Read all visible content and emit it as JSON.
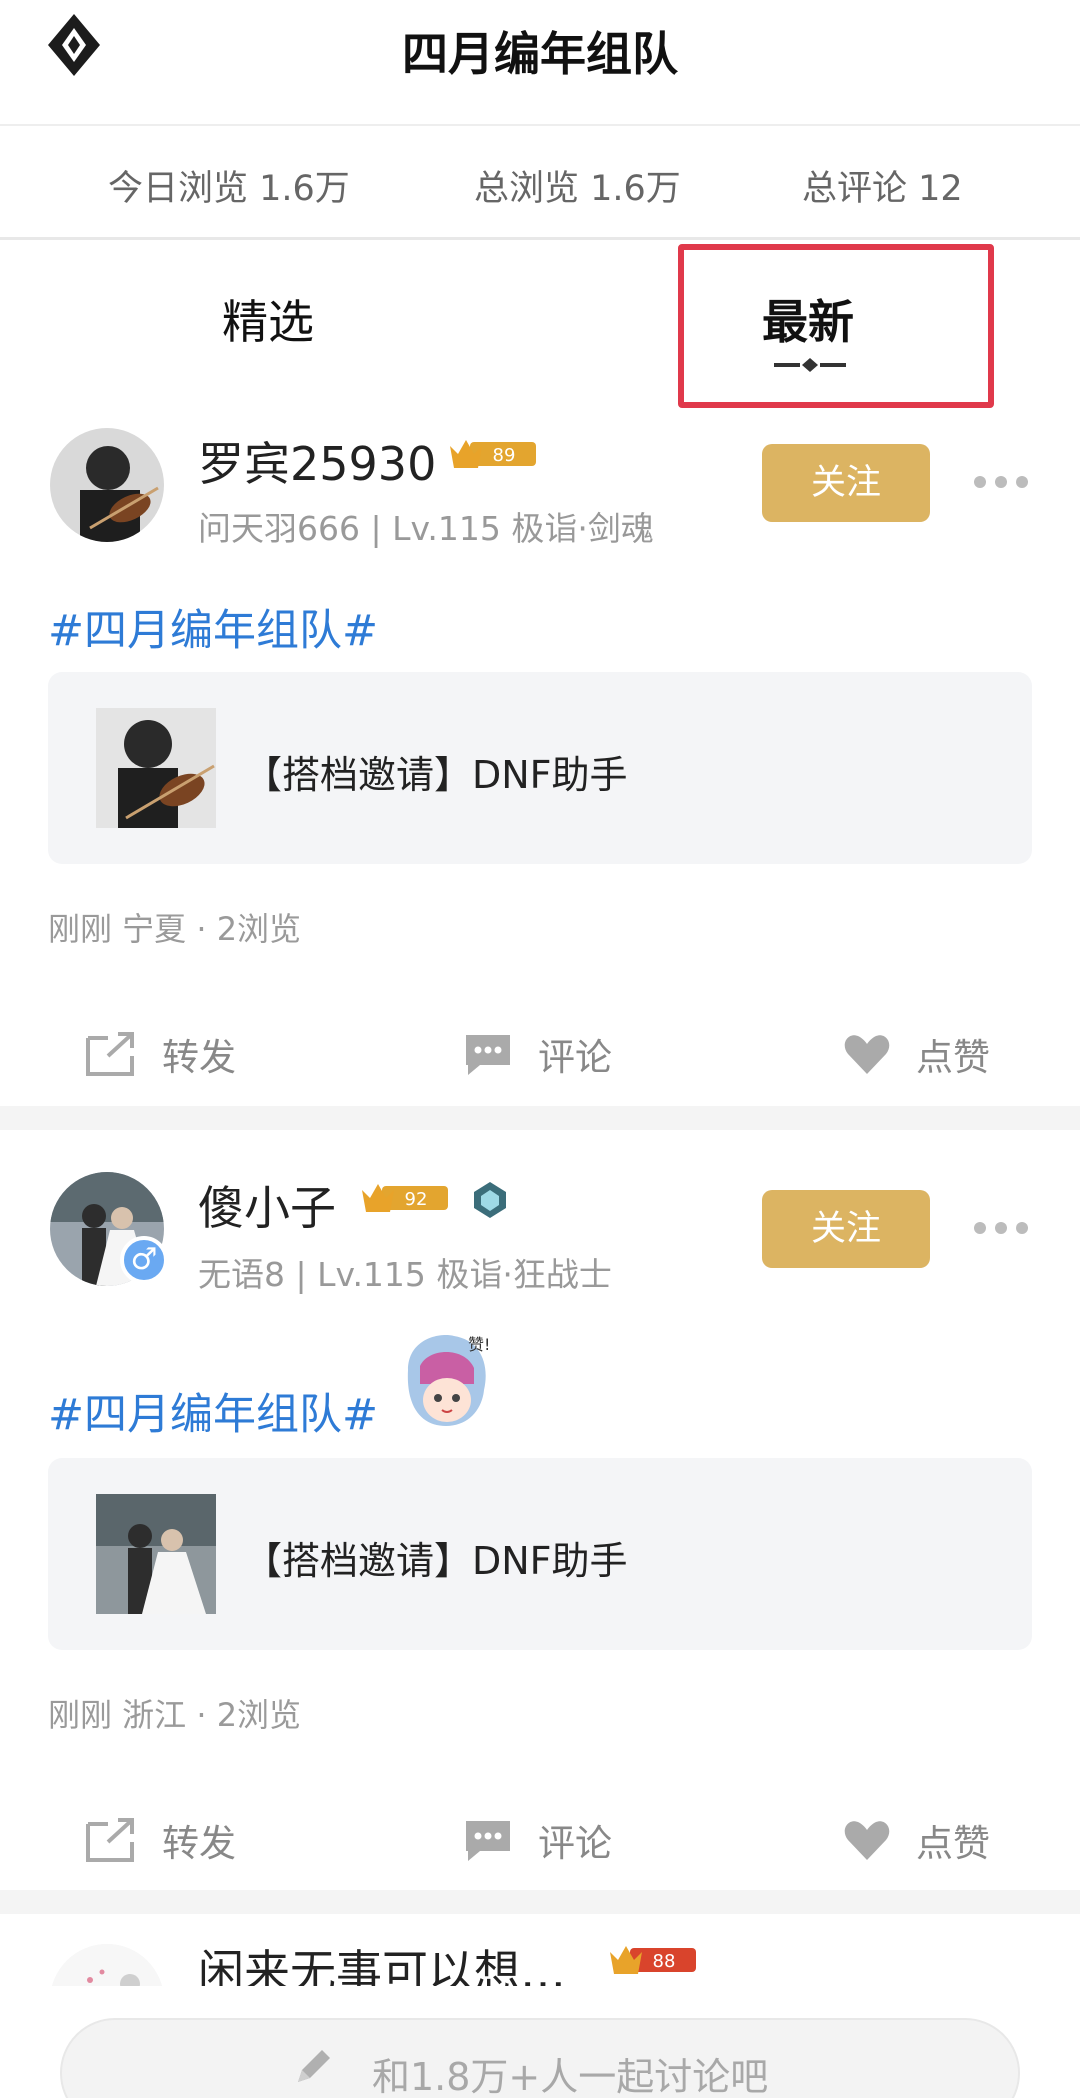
{
  "header": {
    "title": "四月编年组队",
    "logo_icon": "dnf-logo-icon"
  },
  "stats": [
    {
      "label": "今日浏览 1.6万"
    },
    {
      "label": "总浏览 1.6万"
    },
    {
      "label": "总评论 12"
    }
  ],
  "tabs": [
    {
      "label": "精选",
      "active": false
    },
    {
      "label": "最新",
      "active": true
    }
  ],
  "posts": [
    {
      "username": "罗宾25930",
      "level_badge": "89",
      "subinfo": "问天羽666 | Lv.115 极诣·剑魂",
      "follow_label": "关注",
      "topic": "#四月编年组队#",
      "card_text": "【搭档邀请】DNF助手",
      "meta": "刚刚 宁夏 · 2浏览",
      "actions": {
        "share": "转发",
        "comment": "评论",
        "like": "点赞"
      }
    },
    {
      "username": "傻小子",
      "level_badge": "92",
      "gender": "♂",
      "subinfo": "无语8 | Lv.115 极诣·狂战士",
      "follow_label": "关注",
      "topic": "#四月编年组队#",
      "sticker_text": "赞!",
      "card_text": "【搭档邀请】DNF助手",
      "meta": "刚刚 浙江 · 2浏览",
      "actions": {
        "share": "转发",
        "comment": "评论",
        "like": "点赞"
      }
    },
    {
      "username": "闲来无事可以想…",
      "level_badge": "88"
    }
  ],
  "bottom": {
    "input_placeholder": "和1.8万+人一起讨论吧"
  },
  "colors": {
    "accent_gold": "#dcb462",
    "topic_blue": "#2e7bd6",
    "highlight_red": "#e0394b"
  }
}
